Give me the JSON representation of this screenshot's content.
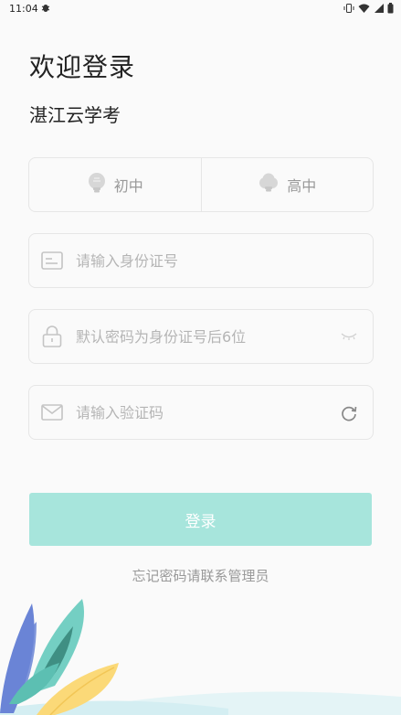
{
  "status_bar": {
    "time": "11:04",
    "notification_icon": "bug-icon",
    "icons": [
      "vibrate-icon",
      "wifi-icon",
      "signal-icon",
      "battery-icon"
    ]
  },
  "login": {
    "title": "欢迎登录",
    "subtitle": "湛江云学考",
    "levels": [
      {
        "label": "初中",
        "icon": "lightbulb-icon"
      },
      {
        "label": "高中",
        "icon": "cloud-lightbulb-icon"
      }
    ],
    "id_field": {
      "placeholder": "请输入身份证号",
      "icon": "id-card-icon"
    },
    "password_field": {
      "placeholder": "默认密码为身份证号后6位",
      "icon": "lock-icon",
      "toggle_icon": "eye-closed-icon"
    },
    "captcha_field": {
      "placeholder": "请输入验证码",
      "icon": "mail-icon",
      "refresh_icon": "refresh-icon"
    },
    "login_button": "登录",
    "forgot_text": "忘记密码请联系管理员"
  },
  "colors": {
    "accent": "#a7e5dc",
    "border": "#e6e6e6",
    "placeholder": "#b5b5b5",
    "muted_text": "#999999"
  }
}
